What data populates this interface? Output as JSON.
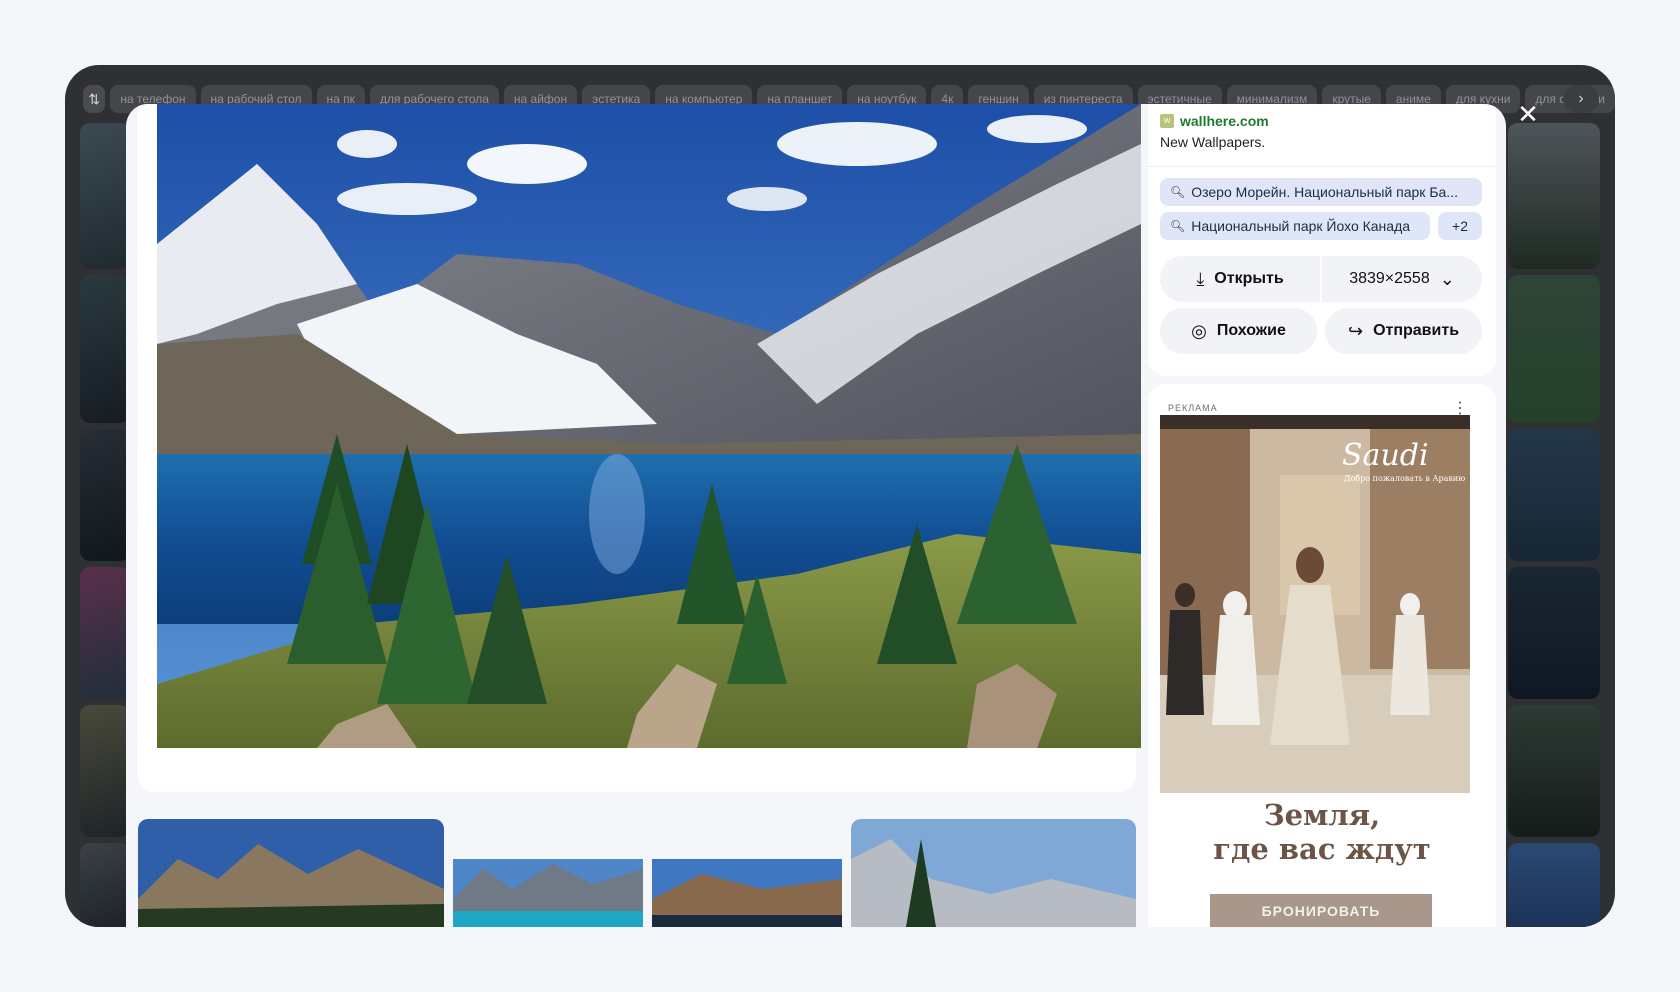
{
  "chips": {
    "filter_icon": "sliders-icon",
    "items": [
      "на телефон",
      "на рабочий стол",
      "на пк",
      "для рабочего стола",
      "на айфон",
      "эстетика",
      "на компьютер",
      "на планшет",
      "на ноутбук",
      "4к",
      "геншин",
      "из пинтереста",
      "эстетичные",
      "минимализм",
      "крутые",
      "аниме",
      "для кухни",
      "для спальни"
    ],
    "next_icon": "chevron-right-icon"
  },
  "viewer": {
    "close_icon": "close-icon",
    "source": {
      "domain": "wallhere.com",
      "title": "New Wallpapers."
    },
    "tags": [
      {
        "label": "Озеро Морейн. Национальный парк Ба..."
      },
      {
        "label": "Национальный парк Йохо Канада"
      }
    ],
    "more_tags": "+2",
    "actions": {
      "open_label": "Открыть",
      "size_label": "3839×2558",
      "similar_label": "Похожие",
      "share_label": "Отправить"
    }
  },
  "ad": {
    "label": "РЕКЛАМА",
    "brand": "Saudi",
    "brand_tagline": "Добро пожаловать в Аравию",
    "headline_line1": "Земля,",
    "headline_line2": "где вас ждут",
    "cta": "БРОНИРОВАТЬ"
  },
  "colors": {
    "frame": "#2f3033",
    "accent_tag": "#dfe6f7",
    "domain_green": "#1e7b2c",
    "ad_text": "#6c5446",
    "ad_button": "#a8978a"
  }
}
